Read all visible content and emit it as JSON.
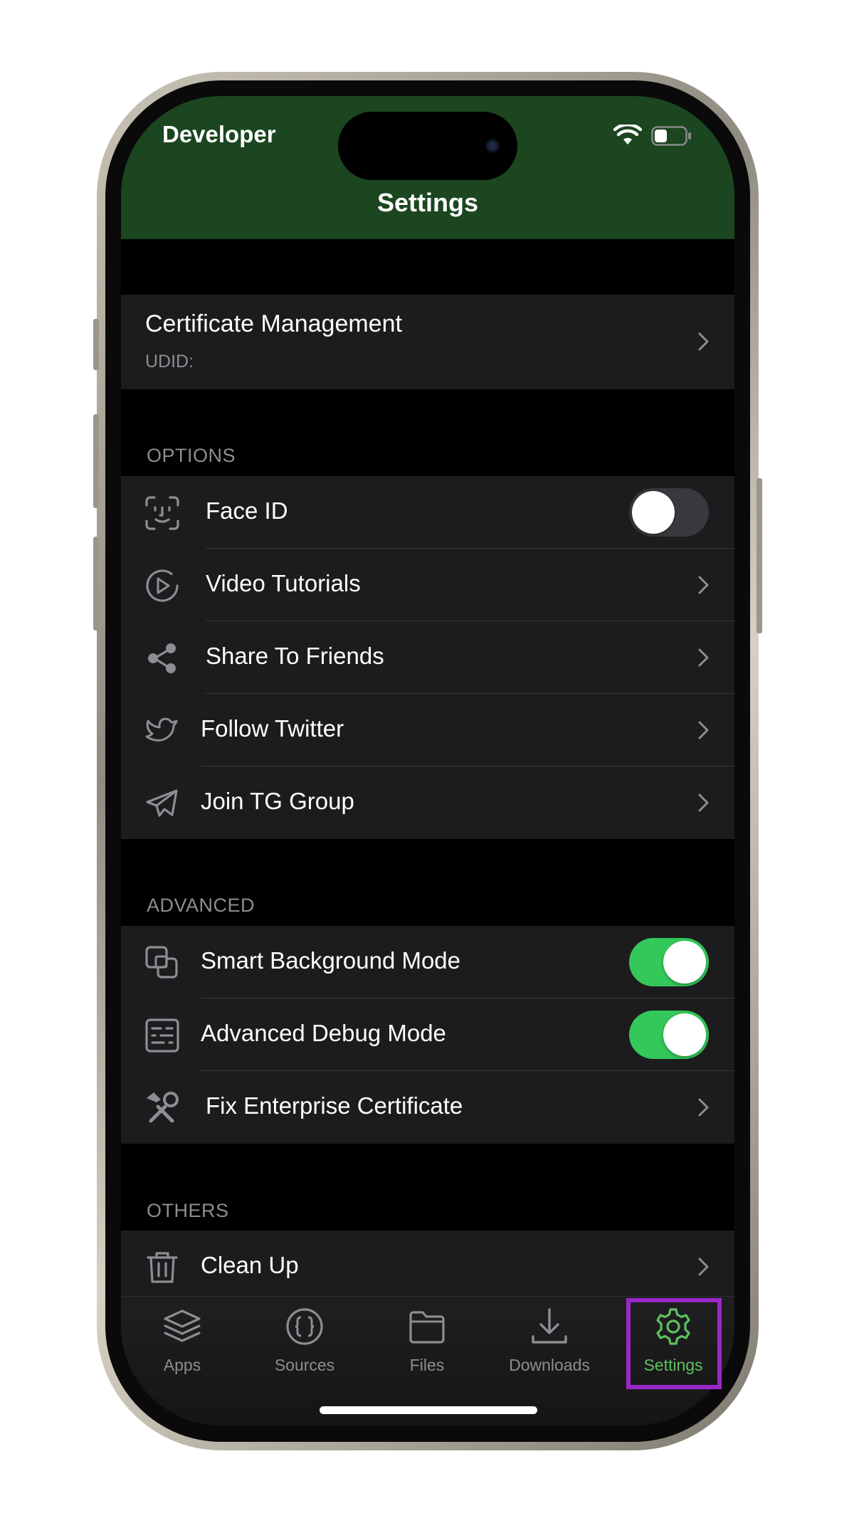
{
  "status_bar": {
    "carrier_label": "Developer"
  },
  "header": {
    "title": "Settings"
  },
  "certificate": {
    "title": "Certificate Management",
    "subtitle": "UDID:"
  },
  "sections": {
    "options": {
      "label": "OPTIONS",
      "items": [
        {
          "label": "Face ID",
          "icon": "face-id-icon",
          "control": "toggle",
          "enabled": false
        },
        {
          "label": "Video Tutorials",
          "icon": "play-circle-icon",
          "control": "chevron"
        },
        {
          "label": "Share To Friends",
          "icon": "share-icon",
          "control": "chevron"
        },
        {
          "label": "Follow Twitter",
          "icon": "twitter-icon",
          "control": "chevron"
        },
        {
          "label": "Join TG Group",
          "icon": "telegram-icon",
          "control": "chevron"
        }
      ]
    },
    "advanced": {
      "label": "ADVANCED",
      "items": [
        {
          "label": "Smart Background Mode",
          "icon": "background-mode-icon",
          "control": "toggle",
          "enabled": true
        },
        {
          "label": "Advanced Debug Mode",
          "icon": "debug-icon",
          "control": "toggle",
          "enabled": true
        },
        {
          "label": "Fix Enterprise Certificate",
          "icon": "tools-icon",
          "control": "chevron"
        }
      ]
    },
    "others": {
      "label": "OTHERS",
      "items": [
        {
          "label": "Clean Up",
          "icon": "trash-icon",
          "control": "chevron"
        }
      ]
    }
  },
  "tabbar": {
    "active": "Settings",
    "tabs": [
      {
        "label": "Apps",
        "icon": "layers-icon"
      },
      {
        "label": "Sources",
        "icon": "braces-icon"
      },
      {
        "label": "Files",
        "icon": "folder-icon"
      },
      {
        "label": "Downloads",
        "icon": "download-icon"
      },
      {
        "label": "Settings",
        "icon": "gear-icon"
      }
    ]
  },
  "colors": {
    "header_bg": "#1b4620",
    "toggle_on": "#34c759",
    "active_tab": "#5fc15e",
    "highlight_box": "#9a27c9",
    "cell_bg": "#1c1c1e"
  }
}
